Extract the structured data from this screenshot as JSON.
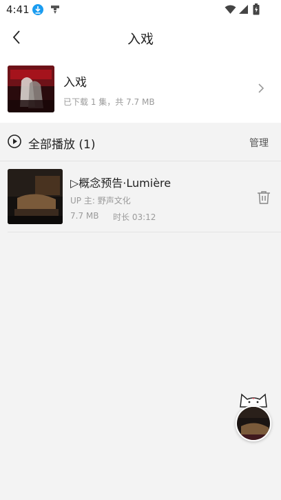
{
  "status_bar": {
    "time": "4:41",
    "download_icon": "download-icon",
    "notification_icon": "notification-icon",
    "wifi_icon": "wifi-icon",
    "signal_icon": "signal-icon",
    "battery_icon": "battery-icon"
  },
  "header": {
    "title": "入戏",
    "back_icon": "chevron-left-icon"
  },
  "album": {
    "name": "入戏",
    "meta": "已下载 1 集，共 7.7 MB",
    "chevron_icon": "chevron-right-icon"
  },
  "play_all": {
    "label": "全部播放 (1)",
    "manage_label": "管理",
    "icon": "play-circle-icon"
  },
  "episodes": [
    {
      "title": "▷概念预告·Lumière",
      "uploader": "UP 主: 野声文化",
      "size": "7.7 MB",
      "duration": "时长 03:12",
      "delete_icon": "trash-icon"
    }
  ],
  "colors": {
    "accent_blue": "#1a9cf0",
    "background": "#f3f3f3",
    "text_primary": "#222222",
    "text_secondary": "#9a9a9a"
  }
}
